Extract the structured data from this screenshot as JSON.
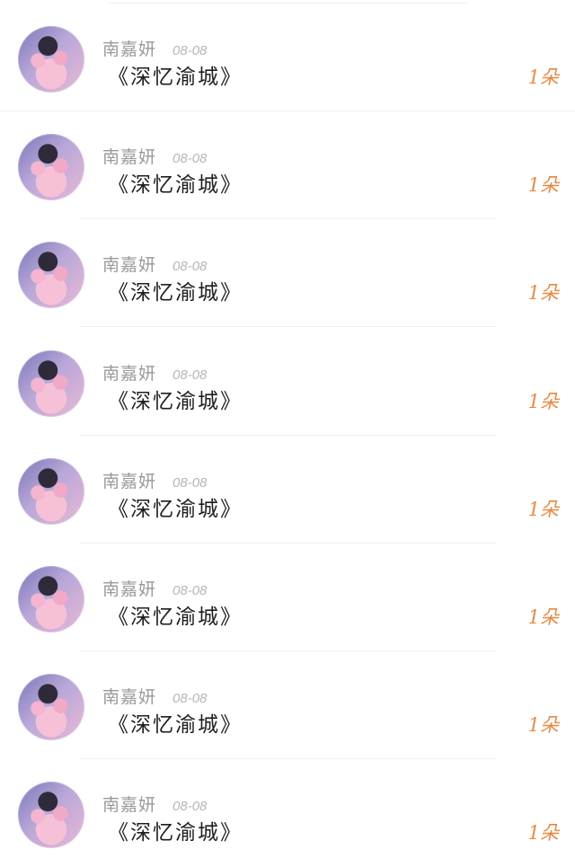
{
  "list": {
    "items": [
      {
        "name": "南嘉妍",
        "date": "08-08",
        "title": "《深忆渝城》",
        "count": "1朵"
      },
      {
        "name": "南嘉妍",
        "date": "08-08",
        "title": "《深忆渝城》",
        "count": "1朵"
      },
      {
        "name": "南嘉妍",
        "date": "08-08",
        "title": "《深忆渝城》",
        "count": "1朵"
      },
      {
        "name": "南嘉妍",
        "date": "08-08",
        "title": "《深忆渝城》",
        "count": "1朵"
      },
      {
        "name": "南嘉妍",
        "date": "08-08",
        "title": "《深忆渝城》",
        "count": "1朵"
      },
      {
        "name": "南嘉妍",
        "date": "08-08",
        "title": "《深忆渝城》",
        "count": "1朵"
      },
      {
        "name": "南嘉妍",
        "date": "08-08",
        "title": "《深忆渝城》",
        "count": "1朵"
      },
      {
        "name": "南嘉妍",
        "date": "08-08",
        "title": "《深忆渝城》",
        "count": "1朵"
      }
    ]
  },
  "colors": {
    "count": "#e58a45",
    "name": "#9a9a9a",
    "date": "#b5b5b5",
    "title": "#1e1e1e"
  }
}
